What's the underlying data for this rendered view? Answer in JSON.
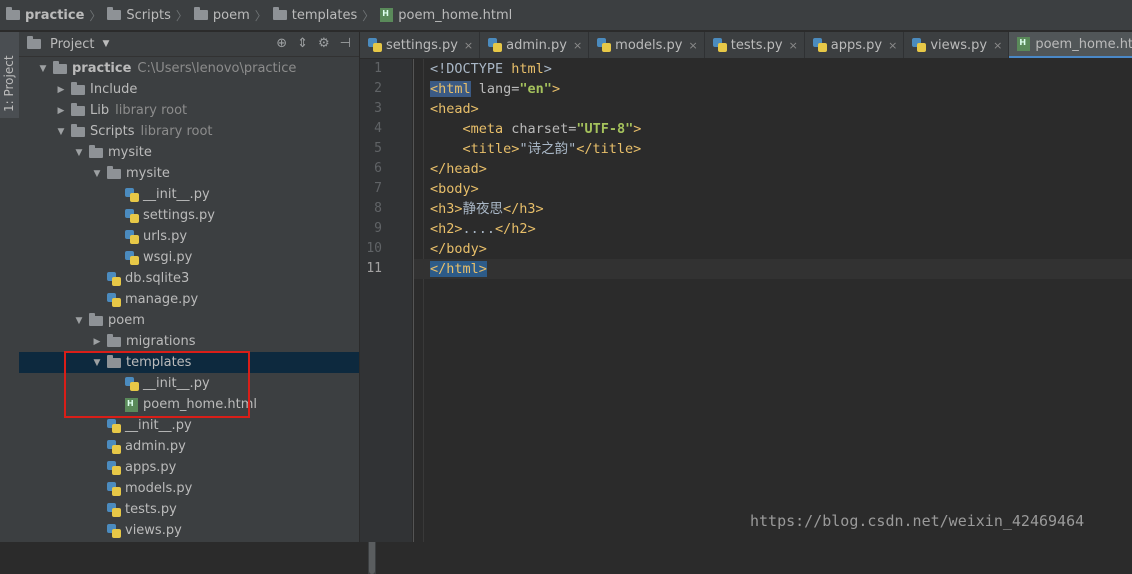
{
  "breadcrumb": [
    "practice",
    "Scripts",
    "poem",
    "templates",
    "poem_home.html"
  ],
  "side_tab": "1: Project",
  "project_panel": {
    "title": "Project",
    "tree": [
      {
        "label": "practice",
        "extra": "C:\\Users\\lenovo\\practice",
        "icon": "folder-icon",
        "arrow": "down"
      },
      {
        "label": "Include",
        "extra": "",
        "icon": "folder-icon",
        "arrow": "right"
      },
      {
        "label": "Lib",
        "extra": "library root",
        "icon": "folder-icon",
        "arrow": "right"
      },
      {
        "label": "Scripts",
        "extra": "library root",
        "icon": "folder-icon",
        "arrow": "down"
      },
      {
        "label": "mysite",
        "extra": "",
        "icon": "folder-icon",
        "arrow": "down"
      },
      {
        "label": "mysite",
        "extra": "",
        "icon": "folder-icon",
        "arrow": "down"
      },
      {
        "label": "__init__.py",
        "extra": "",
        "icon": "python-file-icon",
        "arrow": ""
      },
      {
        "label": "settings.py",
        "extra": "",
        "icon": "python-file-icon",
        "arrow": ""
      },
      {
        "label": "urls.py",
        "extra": "",
        "icon": "python-file-icon",
        "arrow": ""
      },
      {
        "label": "wsgi.py",
        "extra": "",
        "icon": "python-file-icon",
        "arrow": ""
      },
      {
        "label": "db.sqlite3",
        "extra": "",
        "icon": "python-file-icon",
        "arrow": ""
      },
      {
        "label": "manage.py",
        "extra": "",
        "icon": "python-file-icon",
        "arrow": ""
      },
      {
        "label": "poem",
        "extra": "",
        "icon": "folder-icon",
        "arrow": "down"
      },
      {
        "label": "migrations",
        "extra": "",
        "icon": "folder-icon",
        "arrow": "right"
      },
      {
        "label": "templates",
        "extra": "",
        "icon": "folder-icon",
        "arrow": "down"
      },
      {
        "label": "__init__.py",
        "extra": "",
        "icon": "python-file-icon",
        "arrow": ""
      },
      {
        "label": "poem_home.html",
        "extra": "",
        "icon": "html-file-icon",
        "arrow": ""
      },
      {
        "label": "__init__.py",
        "extra": "",
        "icon": "python-file-icon",
        "arrow": ""
      },
      {
        "label": "admin.py",
        "extra": "",
        "icon": "python-file-icon",
        "arrow": ""
      },
      {
        "label": "apps.py",
        "extra": "",
        "icon": "python-file-icon",
        "arrow": ""
      },
      {
        "label": "models.py",
        "extra": "",
        "icon": "python-file-icon",
        "arrow": ""
      },
      {
        "label": "tests.py",
        "extra": "",
        "icon": "python-file-icon",
        "arrow": ""
      },
      {
        "label": "views.py",
        "extra": "",
        "icon": "python-file-icon",
        "arrow": ""
      }
    ]
  },
  "tabs": [
    {
      "label": "settings.py",
      "icon": "python-file-icon",
      "active": false
    },
    {
      "label": "admin.py",
      "icon": "python-file-icon",
      "active": false
    },
    {
      "label": "models.py",
      "icon": "python-file-icon",
      "active": false
    },
    {
      "label": "tests.py",
      "icon": "python-file-icon",
      "active": false
    },
    {
      "label": "apps.py",
      "icon": "python-file-icon",
      "active": false
    },
    {
      "label": "views.py",
      "icon": "python-file-icon",
      "active": false
    },
    {
      "label": "poem_home.html",
      "icon": "html-file-icon",
      "active": true
    }
  ],
  "editor": {
    "line_numbers": [
      "1",
      "2",
      "3",
      "4",
      "5",
      "6",
      "7",
      "8",
      "9",
      "10",
      "11"
    ],
    "lines": [
      "<!DOCTYPE html>",
      "<html lang=\"en\">",
      "<head>",
      "    <meta charset=\"UTF-8\">",
      "    <title>\"诗之韵\"</title>",
      "</head>",
      "<body>",
      "<h3>静夜思</h3>",
      "<h2>....</h2>",
      "</body>",
      "</html>"
    ]
  },
  "watermark": "https://blog.csdn.net/weixin_42469464",
  "colors": {
    "tag": "#e8bf6a",
    "attr_value": "#a5c25c",
    "selection": "#0d293e",
    "highlight_box": "#d91e18"
  }
}
